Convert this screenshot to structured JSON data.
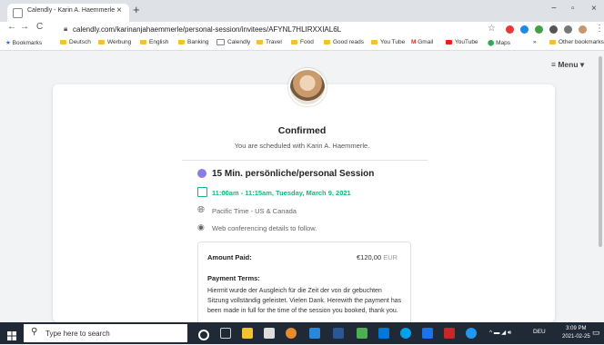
{
  "browser": {
    "tab_title": "Calendly - Karin A. Haemmerle",
    "tab_close": "×",
    "new_tab": "+",
    "url": "calendly.com/karinanjahaemmerle/personal-session/invitees/AFYNL7HLIRXXIAL6L",
    "win_min": "−",
    "win_max": "▫",
    "win_close": "×",
    "back": "←",
    "forward": "→",
    "reload": "C",
    "bookmarks": [
      "Bookmarks",
      "Deutsch",
      "Werbung",
      "English",
      "Banking",
      "Calendly",
      "Travel",
      "Food",
      "Good reads",
      "You Tube",
      "Gmail",
      "YouTube",
      "Maps"
    ],
    "bookmarks_more": "»",
    "other_bookmarks": "Other bookmarks"
  },
  "page": {
    "menu_label": "Menu",
    "confirmed_title": "Confirmed",
    "scheduled_text": "You are scheduled with Karin A. Haemmerle.",
    "event_title": "15 Min. persönliche/personal Session",
    "event_time": "11:00am - 11:15am, Tuesday, March 9, 2021",
    "timezone": "Pacific Time - US & Canada",
    "web_conf": "Web conferencing details to follow.",
    "amount_label": "Amount Paid:",
    "amount_value": "€120,00",
    "amount_currency": "EUR",
    "terms_label": "Payment Terms:",
    "terms_text": "Hiermit wurde der Ausgleich für die Zeit der von dir gebuchten Sitzung vollständig geleistet. Vielen Dank. Herewith the payment has been made in full for the time of the session you booked, thank you."
  },
  "taskbar": {
    "search_placeholder": "Type here to search",
    "lang": "DEU",
    "time": "3:09 PM",
    "date": "2021-02-25"
  },
  "colors": {
    "accent_purple": "#8a7de0",
    "accent_green": "#10b981",
    "taskbar": "#1f2a36"
  }
}
